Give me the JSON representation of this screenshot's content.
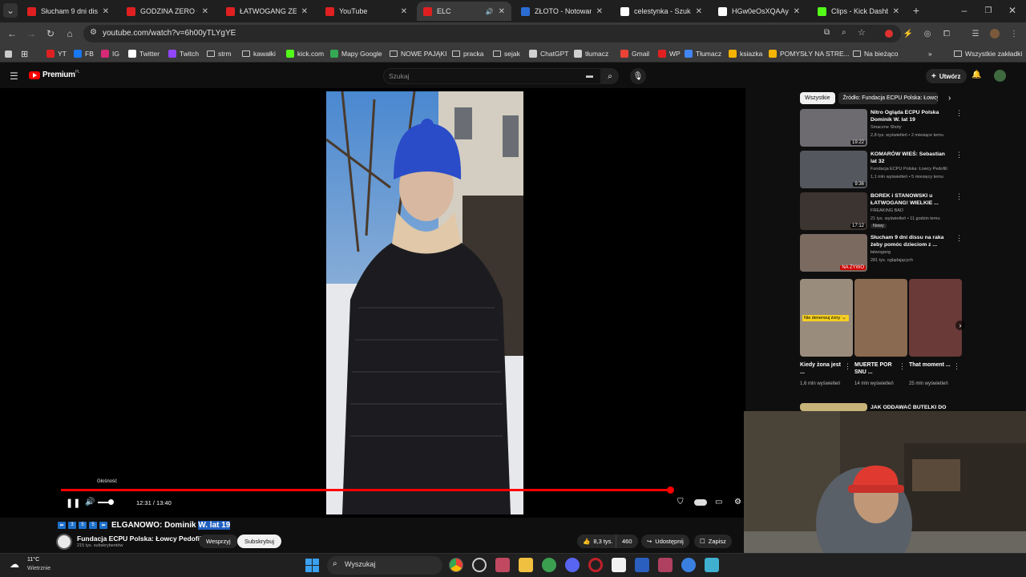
{
  "tabs": [
    {
      "title": "Słucham 9 dni dissu n",
      "fav": "#e02020",
      "icon": "youtube-icon"
    },
    {
      "title": "GODZINA ZERO #18:",
      "fav": "#e02020",
      "icon": "youtube-icon"
    },
    {
      "title": "ŁATWOGANG ZEBRA",
      "fav": "#e02020",
      "icon": "youtube-icon"
    },
    {
      "title": "YouTube",
      "fav": "#e02020",
      "icon": "youtube-icon"
    },
    {
      "title": "ELC",
      "fav": "#e02020",
      "icon": "youtube-icon",
      "active": true
    },
    {
      "title": "ZŁOTO - Notowania",
      "fav": "#2b6cd4",
      "icon": "bankier-icon"
    },
    {
      "title": "celestynka - Szukaj w",
      "fav": "#ffffff",
      "icon": "google-icon"
    },
    {
      "title": "HGw0eOsXQAAyHX",
      "fav": "#ffffff",
      "icon": "x-icon"
    },
    {
      "title": "Clips - Kick Dashboa",
      "fav": "#53fc18",
      "icon": "kick-icon"
    }
  ],
  "address": {
    "url": "youtube.com/watch?v=6h00yTLYgYE"
  },
  "bookmarks": [
    {
      "label": "YT",
      "kind": "icon",
      "color": "#e02020"
    },
    {
      "label": "FB",
      "kind": "icon",
      "color": "#1877f2"
    },
    {
      "label": "IG",
      "kind": "icon",
      "color": "#d62976"
    },
    {
      "label": "Twitter",
      "kind": "icon",
      "color": "#ffffff"
    },
    {
      "label": "Twitch",
      "kind": "icon",
      "color": "#9146ff"
    },
    {
      "label": "strm",
      "kind": "folder"
    },
    {
      "label": "kawałki",
      "kind": "folder"
    },
    {
      "label": "kick.com",
      "kind": "icon",
      "color": "#53fc18"
    },
    {
      "label": "Mapy Google",
      "kind": "icon",
      "color": "#34a853"
    },
    {
      "label": "NOWE PAJĄKI",
      "kind": "folder"
    },
    {
      "label": "pracka",
      "kind": "folder"
    },
    {
      "label": "sejak",
      "kind": "folder"
    },
    {
      "label": "ChatGPT",
      "kind": "icon",
      "color": "#d0d0d0"
    },
    {
      "label": "tłumacz",
      "kind": "icon",
      "color": "#d0d0d0"
    },
    {
      "label": "Gmail",
      "kind": "icon",
      "color": "#ea4335"
    },
    {
      "label": "WP",
      "kind": "icon",
      "color": "#e02020"
    },
    {
      "label": "Tłumacz",
      "kind": "icon",
      "color": "#4285f4"
    },
    {
      "label": "ksiazka",
      "kind": "icon",
      "color": "#f4b400"
    },
    {
      "label": "POMYSŁY NA STRE...",
      "kind": "icon",
      "color": "#f4b400"
    },
    {
      "label": "Na bieżąco",
      "kind": "folder"
    }
  ],
  "bookmarks_all": "Wszystkie zakładki",
  "masthead": {
    "brand": "Premium",
    "region": "PL",
    "search_placeholder": "Szukaj",
    "create": "Utwórz"
  },
  "player": {
    "time": "12:31 / 13:40",
    "volume_tooltip": "Głośność",
    "progress": 0.915,
    "volume": 0.55
  },
  "video": {
    "badges": [
      "⬅",
      "3",
      "5",
      "5",
      "⬅"
    ],
    "title_plain": "ELGANOWO: Dominik ",
    "title_highlight": "W. lat 19",
    "channel": "Fundacja ECPU Polska: Łowcy Pedofili",
    "subs": "215 tys. subskrybentów",
    "support": "Wesprzyj",
    "subscribe": "Subskrybuj",
    "likes": "8,3 tys.",
    "dislikes": "460",
    "share": "Udostępnij",
    "save": "Zapisz"
  },
  "chips": [
    "Wszystkie",
    "Źródło: Fundacja ECPU Polska: Łowcy"
  ],
  "recommendations": [
    {
      "title": "Nitro Ogląda ECPU Polska Dominik W. lat 19",
      "channel": "Smaczne Shoty",
      "meta": "2,8 tys. wyświetleń • 2 miesiące temu",
      "duration": "19:22",
      "thumb": "#6d6a70"
    },
    {
      "title": "KOMARÓW WIEŚ: Sebastian lat 32",
      "channel": "Fundacja ECPU Polska: Łowcy Pedofili",
      "meta": "1,1 mln wyświetleń • 5 miesięcy temu",
      "duration": "9:36",
      "thumb": "#54575d"
    },
    {
      "title": "BOREK i STANOWSKI u ŁATWOGANG! WIELKIE ...",
      "channel": "FREAKING BAD",
      "meta": "21 tys. wyświetleń • 11 godzin temu",
      "badge": "Nowy",
      "duration": "17:12",
      "thumb": "#3b3430"
    },
    {
      "title": "Słucham 9 dni dissu na raka żeby pomóc dzieciom z ...",
      "channel": "łatwogang",
      "meta": "281 tys. oglądających",
      "duration": "NA ŻYWO",
      "thumb": "#7a6a60"
    }
  ],
  "shorts": [
    {
      "title": "Kiedy żona jest ...",
      "views": "1,6 mln wyświetleń",
      "overlay": "Nie denerwuj żony 😠",
      "thumb": "#9a8c7c"
    },
    {
      "title": "MUERTE POR SNU ...",
      "views": "14 mln wyświetleń",
      "thumb": "#8a6a50"
    },
    {
      "title": "That moment ...",
      "views": "25 mln wyświetleń",
      "thumb": "#6a3a38"
    }
  ],
  "next_rec": {
    "title": "JAK ODDAWAĆ BUTELKI DO"
  },
  "taskbar": {
    "temp": "11°C",
    "weather": "Wietrznie",
    "search": "Wyszukaj"
  }
}
